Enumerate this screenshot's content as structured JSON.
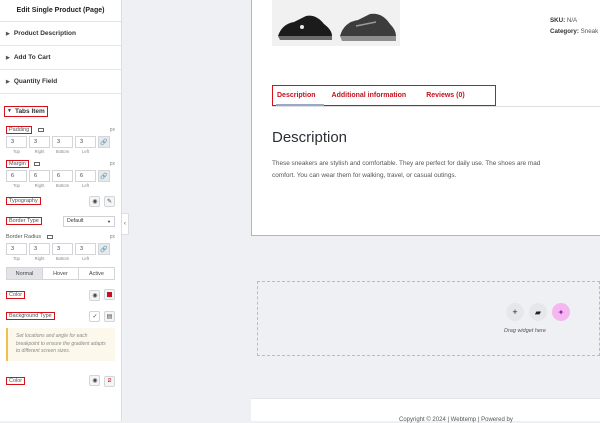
{
  "panel": {
    "title": "Edit Single Product (Page)",
    "sections": [
      "Product Description",
      "Add To Cart",
      "Quantity Field",
      "Tabs Item"
    ],
    "padding": {
      "label": "Padding",
      "unit": "px",
      "values": [
        "3",
        "3",
        "3",
        "3"
      ]
    },
    "margin": {
      "label": "Margin",
      "unit": "px",
      "values": [
        "6",
        "6",
        "6",
        "6"
      ]
    },
    "dim_labels": [
      "Top",
      "Right",
      "Bottom",
      "Left"
    ],
    "typography_label": "Typography",
    "border_type": {
      "label": "Border Type",
      "value": "Default"
    },
    "border_radius": {
      "label": "Border Radius",
      "unit": "px",
      "values": [
        "3",
        "3",
        "3",
        "3"
      ]
    },
    "state_tabs": [
      "Normal",
      "Hover",
      "Active"
    ],
    "color_label": "Color",
    "color_swatch": "#c3121e",
    "background_type_label": "Background Type",
    "info_text": "Set locations and angle for each breakpoint to ensure the gradient adapts to different screen sizes.",
    "color2_label": "Color"
  },
  "product": {
    "sku_label": "SKU:",
    "sku_value": "N/A",
    "category_label": "Category:",
    "category_value": "Sneak",
    "tabs": [
      "Description",
      "Additional information",
      "Reviews (0)"
    ],
    "description_heading": "Description",
    "description_lines": [
      "These sneakers are stylish and comfortable. They are perfect for daily use. The shoes are mad",
      "comfort. You can wear them for walking, travel, or casual outings."
    ]
  },
  "dropzone": {
    "hint": "Drag widget here"
  },
  "footer": {
    "text": "Copyright © 2024 | Webtemp | Powered by"
  },
  "colors": {
    "accent_red": "#d6101a",
    "frame_purple": "#d49ce8",
    "ai_pink": "#f4b7f0"
  }
}
